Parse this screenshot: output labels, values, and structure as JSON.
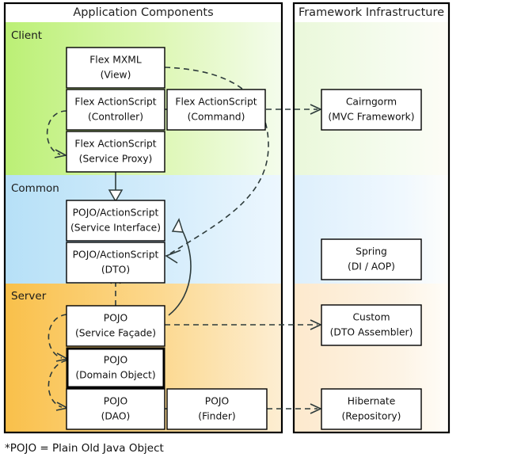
{
  "figure": {
    "footnote": "*POJO = Plain Old Java Object"
  },
  "panels": [
    {
      "id": "application-components",
      "title": "Application Components"
    },
    {
      "id": "framework-infrastructure",
      "title": "Framework Infrastructure"
    }
  ],
  "bands": [
    {
      "id": "client",
      "label": "Client",
      "color_left": "#bbf075",
      "color_right": "#f2fbe8"
    },
    {
      "id": "common",
      "label": "Common",
      "color_left": "#b6e0f7",
      "color_right": "#eaf6fd"
    },
    {
      "id": "server",
      "label": "Server",
      "color_left": "#f9c04a",
      "color_right": "#fdeccd"
    }
  ],
  "boxes": {
    "flex_mxml": {
      "line1": "Flex MXML",
      "line2": "(View)"
    },
    "flex_controller": {
      "line1": "Flex ActionScript",
      "line2": "(Controller)"
    },
    "flex_command": {
      "line1": "Flex ActionScript",
      "line2": "(Command)"
    },
    "flex_service_proxy": {
      "line1": "Flex ActionScript",
      "line2": "(Service Proxy)"
    },
    "pojo_service_interface": {
      "line1": "POJO/ActionScript",
      "line2": "(Service Interface)"
    },
    "pojo_dto": {
      "line1": "POJO/ActionScript",
      "line2": "(DTO)"
    },
    "pojo_service_facade": {
      "line1": "POJO",
      "line2": "(Service Façade)"
    },
    "pojo_domain_object": {
      "line1": "POJO",
      "line2": "(Domain Object)"
    },
    "pojo_dao": {
      "line1": "POJO",
      "line2": "(DAO)"
    },
    "pojo_finder": {
      "line1": "POJO",
      "line2": "(Finder)"
    },
    "cairngorm": {
      "line1": "Cairngorm",
      "line2": "(MVC Framework)"
    },
    "spring": {
      "line1": "Spring",
      "line2": "(DI / AOP)"
    },
    "custom_dto_assembler": {
      "line1": "Custom",
      "line2": "(DTO Assembler)"
    },
    "hibernate": {
      "line1": "Hibernate",
      "line2": "(Repository)"
    }
  },
  "connectors": [
    {
      "id": "controller-to-service-proxy",
      "style": "dashed"
    },
    {
      "id": "mxml-to-dto",
      "style": "dashed"
    },
    {
      "id": "command-to-cairngorm",
      "style": "dashed"
    },
    {
      "id": "service-proxy-to-service-interface",
      "style": "solid"
    },
    {
      "id": "service-facade-to-service-interface",
      "style": "solid"
    },
    {
      "id": "service-facade-to-dto",
      "style": "dashed"
    },
    {
      "id": "service-facade-to-domain-object",
      "style": "dashed"
    },
    {
      "id": "domain-object-to-dao",
      "style": "dashed"
    },
    {
      "id": "service-facade-to-dto-assembler",
      "style": "dashed"
    },
    {
      "id": "finder-to-hibernate",
      "style": "dashed"
    }
  ]
}
